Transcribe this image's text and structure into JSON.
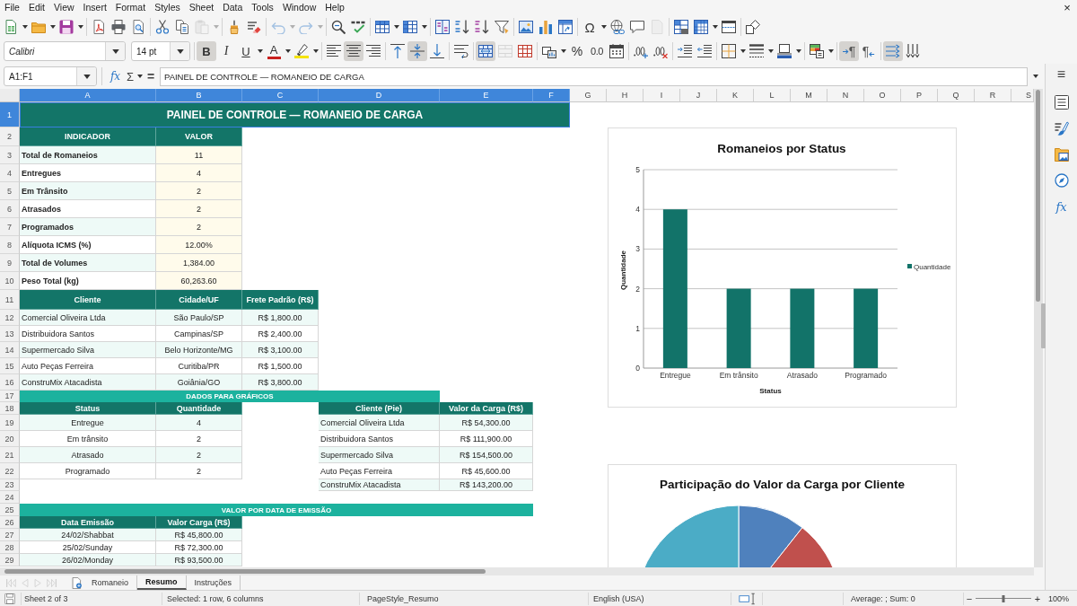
{
  "menu_bar": {
    "items": [
      "File",
      "Edit",
      "View",
      "Insert",
      "Format",
      "Styles",
      "Sheet",
      "Data",
      "Tools",
      "Window",
      "Help"
    ],
    "close": "×"
  },
  "standard_toolbar": {
    "paste_enabled": false,
    "undo_enabled": false,
    "redo_enabled": false,
    "special_character": "Ω",
    "headers_footers_enabled": false
  },
  "formatting_toolbar": {
    "font_name": "Calibri",
    "font_size": "14 pt",
    "bold": {
      "label": "B",
      "on": true
    },
    "italic": {
      "label": "I",
      "on": false
    },
    "underline": {
      "label": "U",
      "on": false
    },
    "font_color_label": "A",
    "horizontal_align": {
      "left": false,
      "center": true,
      "right": false
    },
    "vertical_align": {
      "top": false,
      "center": true,
      "bottom": false
    },
    "merge_and_center": true,
    "merge_cells_enabled": false,
    "percent_format": "%",
    "general_format": "0.0",
    "paragraph_direction": [
      {
        "label": "¶",
        "selected": true
      },
      {
        "label": "¶",
        "selected": false
      }
    ],
    "text_direction": {
      "horizontal": true,
      "vertical": false
    }
  },
  "formula_bar": {
    "name_box": "A1:F1",
    "function_wizard": "fx",
    "sum": "Σ",
    "formula": "=",
    "content": "PAINEL DE CONTROLE — ROMANEIO DE CARGA"
  },
  "sidebar": {
    "menu": "≡",
    "functions": "fx"
  },
  "sheet": {
    "column_headers": [
      {
        "label": "A",
        "selected": true
      },
      {
        "label": "B",
        "selected": true
      },
      {
        "label": "C",
        "selected": true
      },
      {
        "label": "D",
        "selected": true
      },
      {
        "label": "E",
        "selected": true
      },
      {
        "label": "F",
        "selected": true
      },
      {
        "label": "G",
        "selected": false
      },
      {
        "label": "H",
        "selected": false
      },
      {
        "label": "I",
        "selected": false
      },
      {
        "label": "J",
        "selected": false
      },
      {
        "label": "K",
        "selected": false
      },
      {
        "label": "L",
        "selected": false
      },
      {
        "label": "M",
        "selected": false
      },
      {
        "label": "N",
        "selected": false
      },
      {
        "label": "O",
        "selected": false
      },
      {
        "label": "P",
        "selected": false
      },
      {
        "label": "Q",
        "selected": false
      },
      {
        "label": "R",
        "selected": false
      },
      {
        "label": "S",
        "selected": false
      }
    ],
    "row_headers": [
      {
        "label": "1",
        "selected": true
      },
      {
        "label": "2",
        "selected": false
      },
      {
        "label": "3",
        "selected": false
      },
      {
        "label": "4",
        "selected": false
      },
      {
        "label": "5",
        "selected": false
      },
      {
        "label": "6",
        "selected": false
      },
      {
        "label": "7",
        "selected": false
      },
      {
        "label": "8",
        "selected": false
      },
      {
        "label": "9",
        "selected": false
      },
      {
        "label": "10",
        "selected": false
      },
      {
        "label": "11",
        "selected": false
      },
      {
        "label": "12",
        "selected": false
      },
      {
        "label": "13",
        "selected": false
      },
      {
        "label": "14",
        "selected": false
      },
      {
        "label": "15",
        "selected": false
      },
      {
        "label": "16",
        "selected": false
      },
      {
        "label": "17",
        "selected": false
      },
      {
        "label": "18",
        "selected": false
      },
      {
        "label": "19",
        "selected": false
      },
      {
        "label": "20",
        "selected": false
      },
      {
        "label": "21",
        "selected": false
      },
      {
        "label": "22",
        "selected": false
      },
      {
        "label": "23",
        "selected": false
      },
      {
        "label": "24",
        "selected": false
      },
      {
        "label": "25",
        "selected": false
      },
      {
        "label": "26",
        "selected": false
      },
      {
        "label": "27",
        "selected": false
      },
      {
        "label": "28",
        "selected": false
      },
      {
        "label": "29",
        "selected": false
      }
    ],
    "title": {
      "text": "PAINEL DE CONTROLE — ROMANEIO DE CARGA",
      "selected": true
    },
    "indicators": {
      "columns": [
        "INDICADOR",
        "VALOR"
      ],
      "rows": [
        [
          "Total de Romaneios",
          "11"
        ],
        [
          "Entregues",
          "4"
        ],
        [
          "Em Trânsito",
          "2"
        ],
        [
          "Atrasados",
          "2"
        ],
        [
          "Programados",
          "2"
        ],
        [
          "Alíquota ICMS (%)",
          "12.00%"
        ],
        [
          "Total de Volumes",
          "1,384.00"
        ],
        [
          "Peso Total (kg)",
          "60,263.60"
        ]
      ]
    },
    "clients": {
      "columns": [
        "Cliente",
        "Cidade/UF",
        "Frete Padrão (R$)"
      ],
      "rows": [
        [
          "Comercial Oliveira Ltda",
          "São Paulo/SP",
          "R$ 1,800.00"
        ],
        [
          "Distribuidora Santos",
          "Campinas/SP",
          "R$ 2,400.00"
        ],
        [
          "Supermercado Silva",
          "Belo Horizonte/MG",
          "R$ 3,100.00"
        ],
        [
          "Auto Peças Ferreira",
          "Curitiba/PR",
          "R$ 1,500.00"
        ],
        [
          "ConstruMix Atacadista",
          "Goiânia/GO",
          "R$ 3,800.00"
        ]
      ]
    },
    "charts_band": "DADOS PARA GRÁFICOS",
    "status_table": {
      "columns": [
        "Status",
        "Quantidade"
      ],
      "rows": [
        [
          "Entregue",
          "4"
        ],
        [
          "Em trânsito",
          "2"
        ],
        [
          "Atrasado",
          "2"
        ],
        [
          "Programado",
          "2"
        ]
      ]
    },
    "pie_table": {
      "columns": [
        "Cliente (Pie)",
        "Valor da Carga (R$)"
      ],
      "rows": [
        [
          "Comercial Oliveira Ltda",
          "R$ 54,300.00"
        ],
        [
          "Distribuidora Santos",
          "R$ 111,900.00"
        ],
        [
          "Supermercado Silva",
          "R$ 154,500.00"
        ],
        [
          "Auto Peças Ferreira",
          "R$ 45,600.00"
        ],
        [
          "ConstruMix Atacadista",
          "R$ 143,200.00"
        ]
      ]
    },
    "dates_band": "VALOR POR DATA DE EMISSÃO",
    "dates": {
      "columns": [
        "Data Emissão",
        "Valor Carga (R$)"
      ],
      "rows": [
        [
          "24/02/Shabbat",
          "R$ 45,800.00"
        ],
        [
          "25/02/Sunday",
          "R$ 72,300.00"
        ],
        [
          "26/02/Monday",
          "R$ 93,500.00"
        ]
      ]
    },
    "bar_chart": {
      "chart_data": {
        "type": "bar",
        "title": "Romaneios por Status",
        "xlabel": "Status",
        "ylabel": "Quantidade",
        "categories": [
          "Entregue",
          "Em trânsito",
          "Atrasado",
          "Programado"
        ],
        "series": [
          {
            "name": "Quantidade",
            "color": "#127369",
            "values": [
              4,
              2,
              2,
              2
            ]
          }
        ],
        "ylim": [
          0,
          5
        ],
        "yticks": [
          0,
          1,
          2,
          3,
          4,
          5
        ],
        "grid": true
      }
    },
    "pie_chart": {
      "title": "Participação do Valor da Carga por Cliente"
    }
  },
  "sheet_tabs": {
    "navigation_enabled": false,
    "tabs": [
      {
        "label": "Romaneio",
        "selected": false
      },
      {
        "label": "Resumo",
        "selected": true
      },
      {
        "label": "Instruções",
        "selected": false
      }
    ]
  },
  "status_bar": {
    "sheet": "Sheet 2 of 3",
    "selection": "Selected: 1 row, 6 columns",
    "page_style": "PageStyle_Resumo",
    "language": "English (USA)",
    "formula": "Average: ; Sum: 0",
    "zoom_out": "−",
    "zoom_slider": {
      "level": 0.5
    },
    "zoom_in": "+",
    "zoom": "100%"
  }
}
